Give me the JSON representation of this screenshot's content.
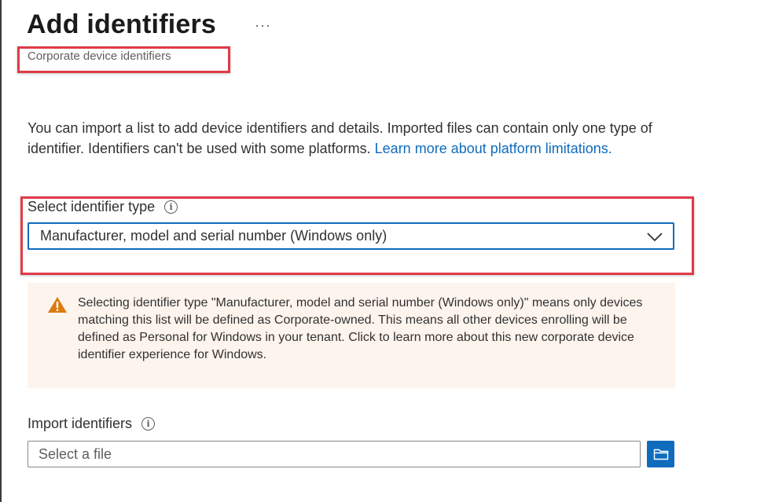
{
  "header": {
    "title": "Add identifiers",
    "more_label": "···",
    "subtitle": "Corporate device identifiers"
  },
  "description": {
    "text": "You can import a list to add device identifiers and details. Imported files can contain only one type of identifier. Identifiers can't be used with some platforms. ",
    "link_text": "Learn more about platform limitations."
  },
  "identifier_type": {
    "label": "Select identifier type",
    "info_icon": "i",
    "selected_value": "Manufacturer, model and serial number (Windows only)"
  },
  "warning": {
    "icon": "warning-icon",
    "text": "Selecting identifier type \"Manufacturer, model and serial number (Windows only)\" means only devices matching this list will be defined as Corporate-owned. This means all other devices enrolling will be defined as Personal for Windows in your tenant. Click to learn more about this new corporate device identifier experience for Windows."
  },
  "import": {
    "label": "Import identifiers",
    "info_icon": "i",
    "placeholder": "Select a file",
    "browse_icon": "folder-icon"
  },
  "colors": {
    "accent": "#0f6cbd",
    "highlight": "#e03a46",
    "warning_bg": "#fdf4ee",
    "warning_icon": "#da7b11"
  }
}
